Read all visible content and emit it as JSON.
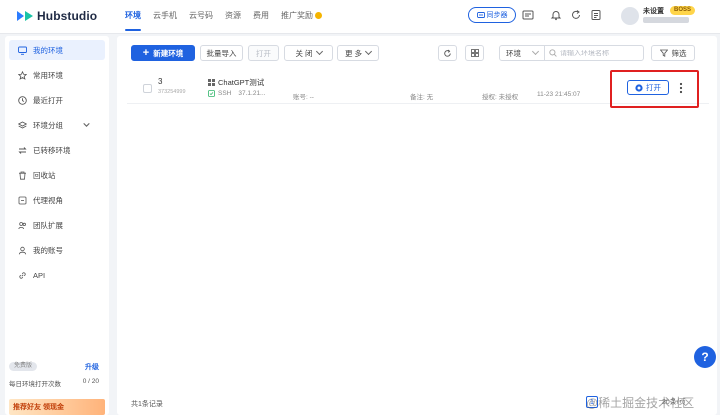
{
  "app": {
    "logo_text": "Hubstudio"
  },
  "nav": [
    {
      "label": "环境"
    },
    {
      "label": "云手机"
    },
    {
      "label": "云号码"
    },
    {
      "label": "资源"
    },
    {
      "label": "费用"
    },
    {
      "label": "推广奖励"
    }
  ],
  "topbar": {
    "sync_label": "同步器",
    "user_name": "未设置",
    "user_badge": "BOSS"
  },
  "sidebar": {
    "items": [
      {
        "label": "我的环境",
        "icon": "monitor-icon"
      },
      {
        "label": "常用环境",
        "icon": "star-icon"
      },
      {
        "label": "最近打开",
        "icon": "clock-icon"
      },
      {
        "label": "环境分组",
        "icon": "layers-icon"
      },
      {
        "label": "已转移环境",
        "icon": "transfer-icon"
      },
      {
        "label": "回收站",
        "icon": "trash-icon"
      },
      {
        "label": "代理视角",
        "icon": "proxy-icon"
      },
      {
        "label": "团队扩展",
        "icon": "team-icon"
      },
      {
        "label": "我的账号",
        "icon": "user-icon"
      },
      {
        "label": "API",
        "icon": "link-icon"
      }
    ],
    "plan_badge": "免费版",
    "upgrade_label": "升级",
    "quota_label": "每日环境打开次数",
    "quota_value": "0 / 20",
    "promo_label": "推荐好友 领现金"
  },
  "toolbar": {
    "new_env": "新建环境",
    "batch_import": "批量导入",
    "open": "打开",
    "close": "关 闭",
    "more": "更 多",
    "env_select": "环境",
    "search_placeholder": "请输入环境名称",
    "filter": "筛选"
  },
  "env_rows": [
    {
      "index": "3",
      "id": "373254999",
      "name": "ChatGPT测试",
      "proxy": "SSH",
      "ip": "37.1.21...",
      "account": "账号: --",
      "remark": "备注: 无",
      "auth": "授权: 未授权",
      "time": "11-23 21:45:07",
      "open_label": "打开"
    }
  ],
  "footer": {
    "total": "共1条记录",
    "page": "1",
    "page_size": "20条/页"
  },
  "help": {
    "label": "?"
  },
  "watermark": "@稀土掘金技术社区"
}
